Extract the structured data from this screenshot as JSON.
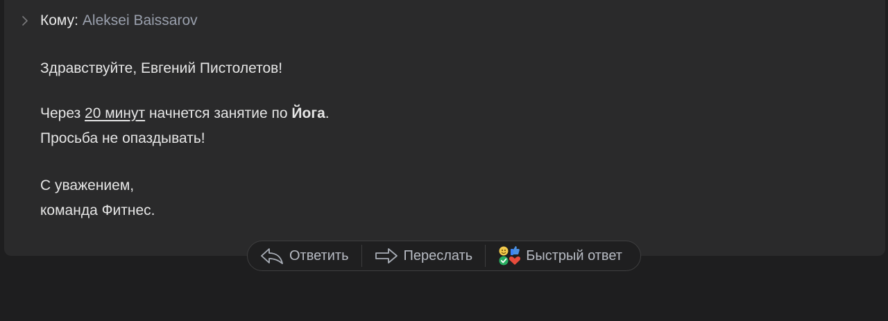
{
  "recipient": {
    "label": "Кому:",
    "value": "Aleksei Baissarov"
  },
  "message": {
    "greeting": "Здравствуйте, Евгений Пистолетов!",
    "line1_prefix": "Через ",
    "line1_duration": "20 минут",
    "line1_middle": " начнется занятие по ",
    "line1_class": "Йога",
    "line1_suffix": ".",
    "line2": "Просьба не опаздывать!",
    "sign_line1": "С уважением,",
    "sign_line2": "команда Фитнес."
  },
  "actions": {
    "reply_label": "Ответить",
    "forward_label": "Переслать",
    "quick_reply_label": "Быстрый ответ"
  },
  "icons": {
    "chevron": "chevron-right-icon",
    "reply": "reply-arrow-icon",
    "forward": "forward-arrow-icon",
    "quick_reply": "emoji-reactions-icon"
  },
  "colors": {
    "background": "#1e1e1f",
    "card": "#2a2a2b",
    "text": "#e6e6e6",
    "muted": "#9aa0ad",
    "action_text": "#b8bcc4"
  }
}
